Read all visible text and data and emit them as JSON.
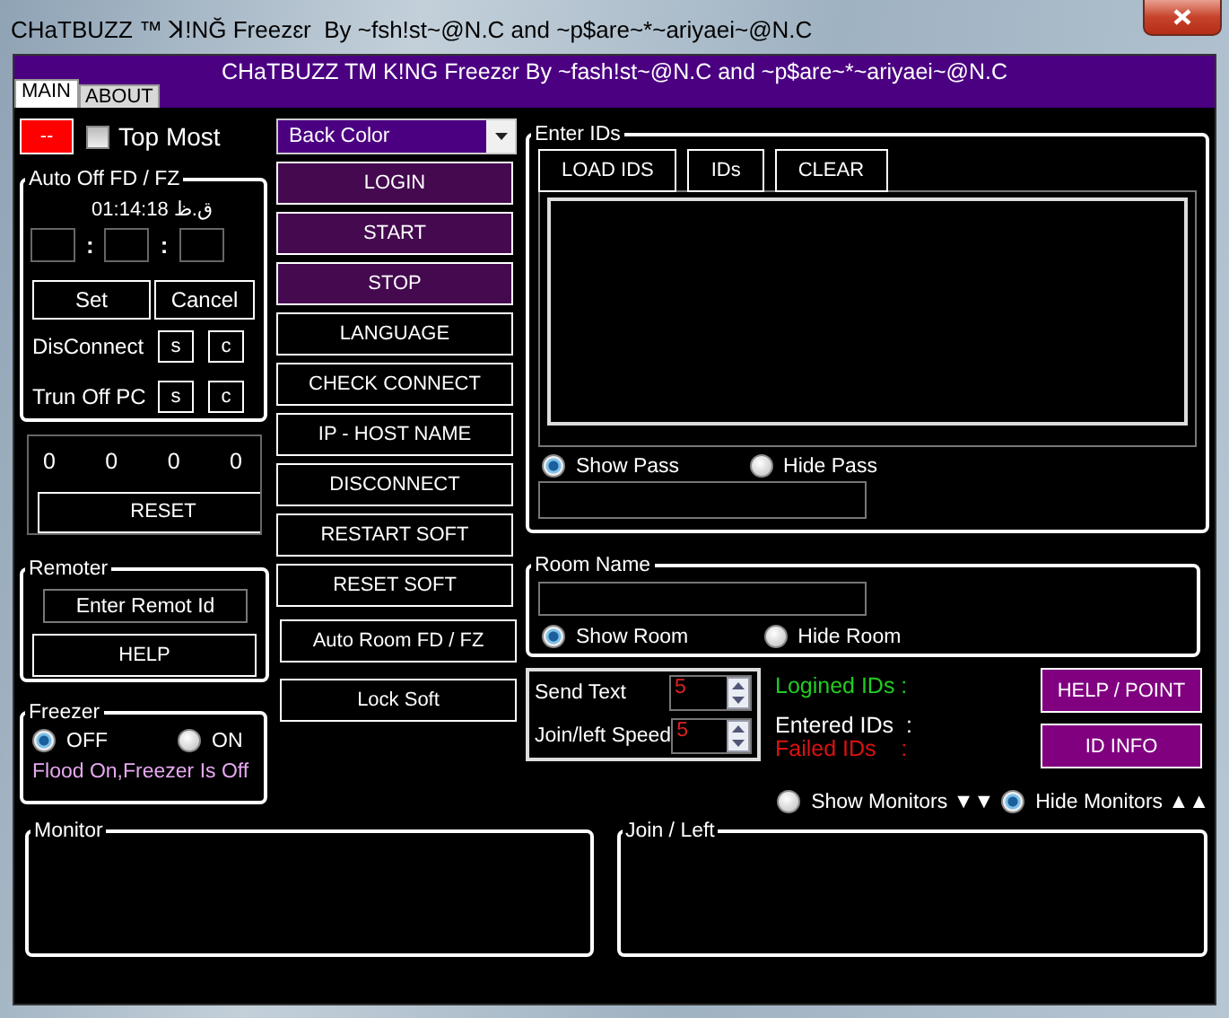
{
  "window": {
    "title": "CHaTBUZZ ™ ꓘ!NĞ Freezɛr  By ~fsh!st~@N.C and ~p$are~*~ariyaei~@N.C"
  },
  "header": {
    "title": "CHaTBUZZ TM K!NG Freezɛr By ~fash!st~@N.C and ~p$are~*~ariyaei~@N.C"
  },
  "tabs": [
    {
      "label": "MAIN",
      "selected": true
    },
    {
      "label": "ABOUT",
      "selected": false
    }
  ],
  "color_button": {
    "label": "--"
  },
  "top_most": {
    "label": "Top Most",
    "checked": false
  },
  "auto_off": {
    "title": "Auto Off FD / FZ",
    "clock": "01:14:18 ق.ظ",
    "separators": [
      ":",
      ":"
    ],
    "set": "Set",
    "cancel": "Cancel",
    "rows": [
      {
        "label": "DisConnect",
        "buttons": [
          "s",
          "c"
        ]
      },
      {
        "label": "Trun Off PC",
        "buttons": [
          "s",
          "c"
        ]
      }
    ]
  },
  "counters": {
    "values": [
      "0",
      "0",
      "0",
      "0"
    ],
    "reset": "RESET"
  },
  "remoter": {
    "title": "Remoter",
    "field": {
      "value": "Enter Remot Id"
    },
    "help": "HELP"
  },
  "freezer": {
    "title": "Freezer",
    "options": [
      {
        "label": "OFF",
        "selected": true
      },
      {
        "label": "ON",
        "selected": false
      }
    ],
    "status": "Flood On,Freezer Is Off"
  },
  "back_color": {
    "value": "Back Color"
  },
  "actions": [
    {
      "label": "LOGIN",
      "kind": "accent"
    },
    {
      "label": "START",
      "kind": "accent"
    },
    {
      "label": "STOP",
      "kind": "accent"
    },
    {
      "label": "LANGUAGE",
      "kind": "plain"
    },
    {
      "label": "CHECK CONNECT",
      "kind": "plain"
    },
    {
      "label": "IP - HOST NAME",
      "kind": "plain"
    },
    {
      "label": "DISCONNECT",
      "kind": "plain"
    },
    {
      "label": "RESTART SOFT",
      "kind": "plain"
    },
    {
      "label": "RESET SOFT",
      "kind": "plain"
    },
    {
      "label": "Auto Room FD / FZ",
      "kind": "plain"
    },
    {
      "label": "Lock Soft",
      "kind": "plain"
    }
  ],
  "enter_ids": {
    "title": "Enter IDs",
    "buttons": [
      "LOAD IDS",
      "IDs",
      "CLEAR"
    ],
    "pass_options": [
      {
        "label": "Show Pass",
        "selected": true
      },
      {
        "label": "Hide Pass",
        "selected": false
      }
    ]
  },
  "room": {
    "title": "Room Name",
    "options": [
      {
        "label": "Show Room",
        "selected": true
      },
      {
        "label": "Hide Room",
        "selected": false
      }
    ]
  },
  "speeds": [
    {
      "label": "Send Text",
      "value": "5"
    },
    {
      "label": "Join/left Speed",
      "value": "5"
    }
  ],
  "stats": [
    {
      "label": "Logined IDs :",
      "color": "#22cc22"
    },
    {
      "label": "Entered IDs  :",
      "color": "#ffffff"
    },
    {
      "label": "Failed IDs    :",
      "color": "#dd1111"
    }
  ],
  "info_buttons": [
    "HELP / POINT",
    "ID INFO"
  ],
  "monitor_options": [
    {
      "label": "Show Monitors ▼▼",
      "selected": false
    },
    {
      "label": "Hide Monitors ▲▲",
      "selected": true
    }
  ],
  "monitors": [
    {
      "title": "Monitor"
    },
    {
      "title": "Join / Left"
    }
  ]
}
